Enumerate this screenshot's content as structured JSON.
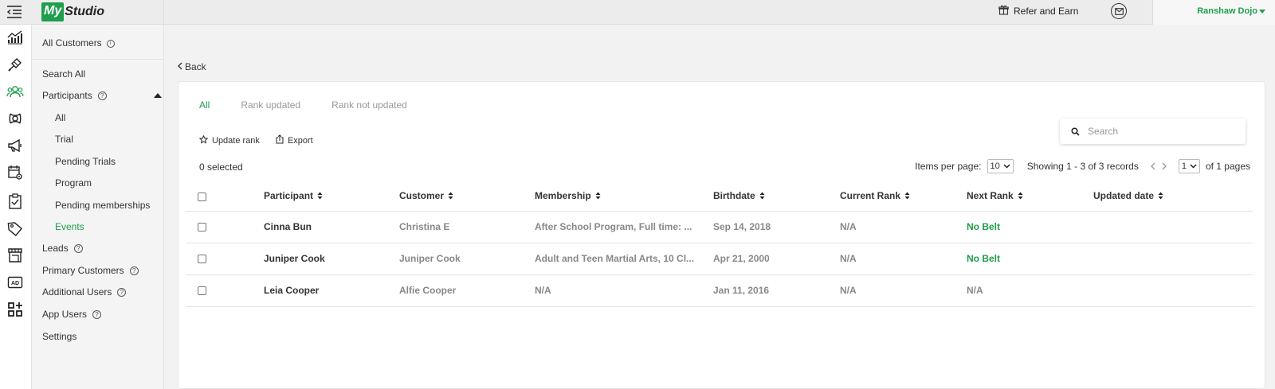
{
  "header": {
    "logo_my": "My",
    "logo_studio": "Studio",
    "refer_label": "Refer and Earn",
    "user_name": "Ranshaw Dojo"
  },
  "rail": {
    "icons": [
      "dashboard-icon",
      "tools-icon",
      "customers-icon",
      "programs-icon",
      "marketing-icon",
      "calendar-settings-icon",
      "checklist-icon",
      "tag-icon",
      "store-icon",
      "ad-icon",
      "apps-icon"
    ],
    "active": "customers-icon",
    "active_color": "#1f9e4b"
  },
  "subnav": {
    "title": "All Customers",
    "search_all": "Search All",
    "participants": "Participants",
    "participant_items": [
      "All",
      "Trial",
      "Pending Trials",
      "Program",
      "Pending memberships",
      "Events"
    ],
    "active_item": "Events",
    "leads": "Leads",
    "primary_customers": "Primary Customers",
    "additional_users": "Additional Users",
    "app_users": "App Users",
    "settings": "Settings"
  },
  "main": {
    "back_label": "Back",
    "tabs": [
      "All",
      "Rank updated",
      "Rank not updated"
    ],
    "active_tab": "All",
    "update_rank_label": "Update rank",
    "export_label": "Export",
    "search_placeholder": "Search",
    "selected_text": "0 selected",
    "items_per_page_label": "Items per page:",
    "items_per_page_value": "10",
    "showing_text": "Showing 1 - 3 of 3 records",
    "page_value": "1",
    "of_pages_text": "of 1 pages"
  },
  "table": {
    "columns": [
      "Participant",
      "Customer",
      "Membership",
      "Birthdate",
      "Current Rank",
      "Next Rank",
      "Updated date"
    ],
    "rows": [
      {
        "participant": "Cinna Bun",
        "customer": "Christina E",
        "membership": "After School Program, Full time: ...",
        "birthdate": "Sep 14, 2018",
        "current_rank": "N/A",
        "next_rank": "No Belt",
        "updated_date": ""
      },
      {
        "participant": "Juniper Cook",
        "customer": "Juniper Cook",
        "membership": "Adult and Teen Martial Arts, 10 Cl...",
        "birthdate": "Apr 21, 2000",
        "current_rank": "N/A",
        "next_rank": "No Belt",
        "updated_date": ""
      },
      {
        "participant": "Leia Cooper",
        "customer": "Alfie Cooper",
        "membership": "N/A",
        "birthdate": "Jan 11, 2016",
        "current_rank": "N/A",
        "next_rank": "N/A",
        "updated_date": ""
      }
    ]
  },
  "colors": {
    "accent": "#1f9e4b",
    "muted_text": "#888888"
  }
}
